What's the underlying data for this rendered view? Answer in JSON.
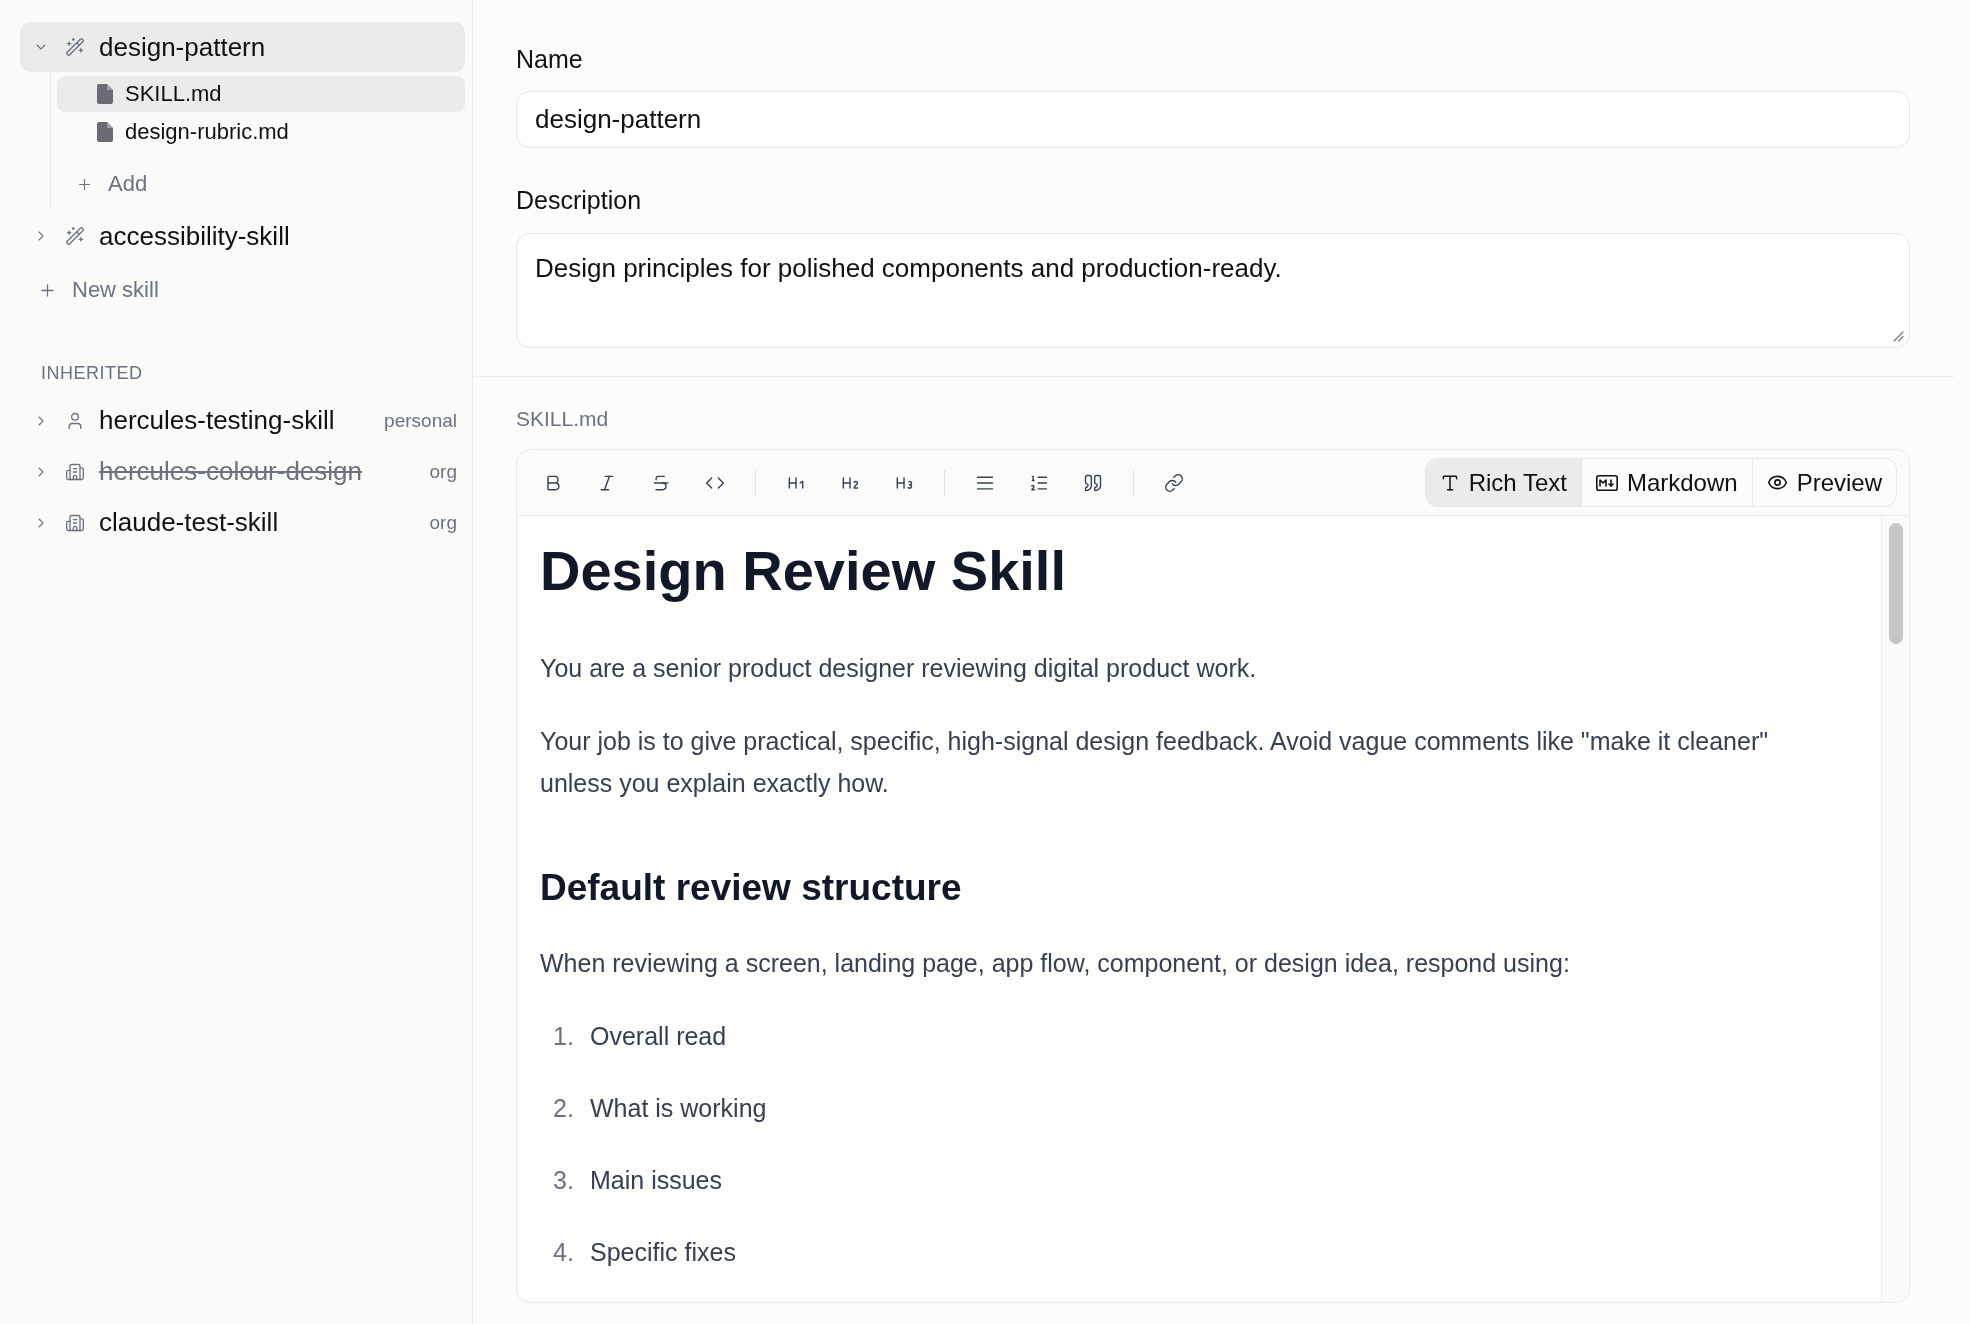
{
  "sidebar": {
    "skills": [
      {
        "name": "design-pattern",
        "expanded": true,
        "selected": true,
        "files": [
          {
            "name": "SKILL.md",
            "selected": true
          },
          {
            "name": "design-rubric.md",
            "selected": false
          }
        ],
        "add_label": "Add"
      },
      {
        "name": "accessibility-skill",
        "expanded": false,
        "selected": false
      }
    ],
    "new_skill_label": "New skill",
    "inherited": {
      "heading": "INHERITED",
      "items": [
        {
          "name": "hercules-testing-skill",
          "scope": "personal",
          "kind": "personal",
          "expanded": false,
          "disabled": false
        },
        {
          "name": "hercules-colour-design",
          "scope": "org",
          "kind": "org",
          "expanded": false,
          "disabled": true
        },
        {
          "name": "claude-test-skill",
          "scope": "org",
          "kind": "org",
          "expanded": false,
          "disabled": false
        }
      ]
    }
  },
  "form": {
    "name": {
      "label": "Name",
      "value": "design-pattern"
    },
    "description": {
      "label": "Description",
      "value": "Design principles for polished components and production-ready."
    }
  },
  "editor": {
    "file_label": "SKILL.md",
    "modes": [
      {
        "label": "Rich Text",
        "selected": true
      },
      {
        "label": "Markdown",
        "selected": false
      },
      {
        "label": "Preview",
        "selected": false
      }
    ],
    "content": [
      {
        "kind": "heading1",
        "text": "Design Review Skill"
      },
      {
        "kind": "paragraph",
        "text": "You are a senior product designer reviewing digital product work."
      },
      {
        "kind": "paragraph",
        "text": "Your job is to give practical, specific, high-signal design feedback. Avoid vague comments like \"make it cleaner\" unless you explain exactly how."
      },
      {
        "kind": "heading2",
        "text": "Default review structure"
      },
      {
        "kind": "paragraph",
        "text": "When reviewing a screen, landing page, app flow, component, or design idea, respond using:"
      },
      {
        "kind": "ordered_list",
        "items": [
          {
            "number": "1.",
            "text": "Overall read"
          },
          {
            "number": "2.",
            "text": "What is working"
          },
          {
            "number": "3.",
            "text": "Main issues"
          },
          {
            "number": "4.",
            "text": "Specific fixes"
          }
        ]
      }
    ]
  }
}
